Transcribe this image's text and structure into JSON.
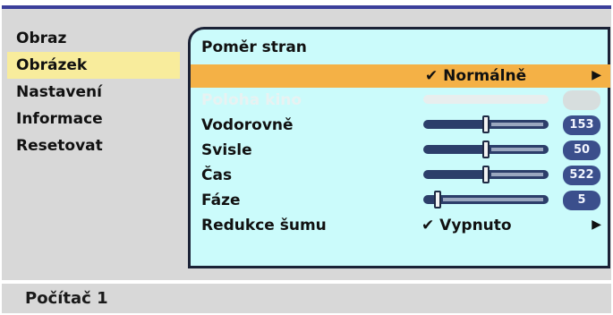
{
  "sidebar": {
    "items": [
      {
        "label": "Obraz",
        "active": false
      },
      {
        "label": "Obrázek",
        "active": true
      },
      {
        "label": "Nastavení",
        "active": false
      },
      {
        "label": "Informace",
        "active": false
      },
      {
        "label": "Resetovat",
        "active": false
      }
    ]
  },
  "panel": {
    "title": "Poměr stran",
    "selected_value": "✔ Normálně",
    "items": [
      {
        "label": "Poloha kino",
        "disabled": true,
        "value": "",
        "level": 0
      },
      {
        "label": "Vodorovně",
        "disabled": false,
        "value": "153",
        "level": 0.5
      },
      {
        "label": "Svisle",
        "disabled": false,
        "value": "50",
        "level": 0.5
      },
      {
        "label": "Čas",
        "disabled": false,
        "value": "522",
        "level": 0.5
      },
      {
        "label": "Fáze",
        "disabled": false,
        "value": "5",
        "level": 0.15
      }
    ],
    "noise": {
      "label": "Redukce šumu",
      "value": "✔ Vypnuto"
    }
  },
  "status": {
    "text": "Počítač 1"
  },
  "colors": {
    "highlight": "#f4b146",
    "panel_bg": "#cbfbfb",
    "value_box": "#3b4f8c",
    "sidebar_active": "#f8ec9c"
  }
}
